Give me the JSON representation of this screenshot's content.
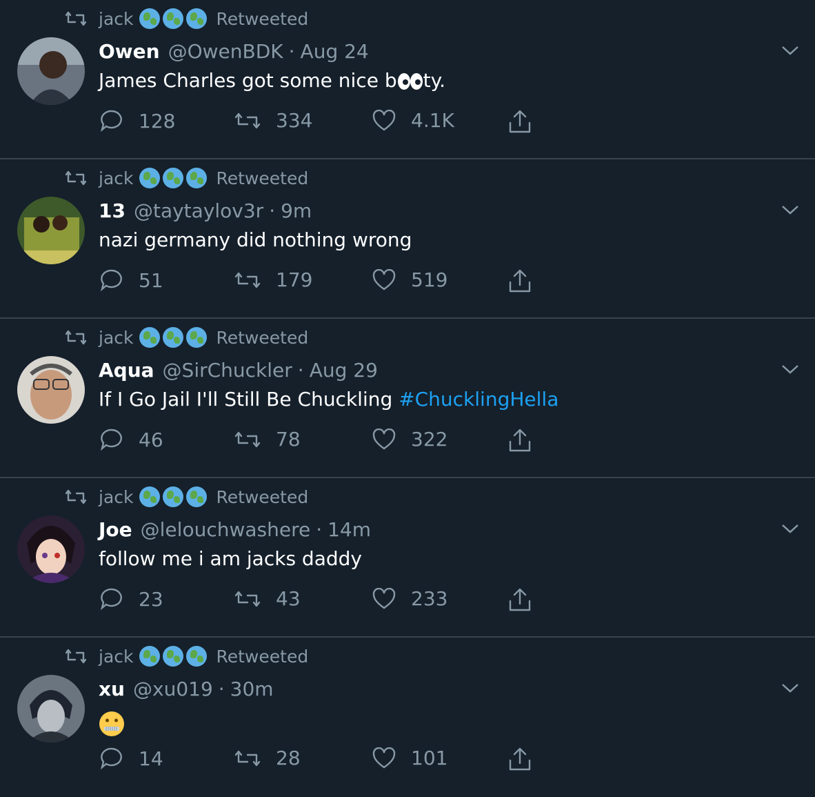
{
  "retweet_label": "Retweeted",
  "retweeter": "jack",
  "globe_icons": [
    "globe-africa-europe-icon",
    "globe-asia-australia-icon",
    "globe-americas-icon"
  ],
  "colors": {
    "background": "#15202b",
    "muted": "#8899a6",
    "accent": "#1da1f2",
    "divider": "#38444d"
  },
  "tweets": [
    {
      "name": "Owen",
      "handle": "@OwenBDK",
      "time": "Aug 24",
      "text_before": "James Charles got some nice b",
      "emoji": "eyes-emoji",
      "text_after": "ty.",
      "hashtag": "",
      "replies": "128",
      "retweets": "334",
      "likes": "4.1K"
    },
    {
      "name": "13",
      "handle": "@taytaylov3r",
      "time": "9m",
      "text_before": "nazi germany did nothing wrong",
      "emoji": "",
      "text_after": "",
      "hashtag": "",
      "replies": "51",
      "retweets": "179",
      "likes": "519"
    },
    {
      "name": "Aqua",
      "handle": "@SirChuckler",
      "time": "Aug 29",
      "text_before": "If I Go Jail I'll Still Be Chuckling ",
      "emoji": "",
      "text_after": "",
      "hashtag": "#ChucklingHella",
      "replies": "46",
      "retweets": "78",
      "likes": "322"
    },
    {
      "name": "Joe",
      "handle": "@lelouchwashere",
      "time": "14m",
      "text_before": "follow me i am jacks daddy",
      "emoji": "",
      "text_after": "",
      "hashtag": "",
      "replies": "23",
      "retweets": "43",
      "likes": "233"
    },
    {
      "name": "xu",
      "handle": "@xu019",
      "time": "30m",
      "text_before": "",
      "emoji": "zipper-mouth-face-emoji",
      "text_after": "",
      "hashtag": "",
      "replies": "14",
      "retweets": "28",
      "likes": "101"
    }
  ]
}
